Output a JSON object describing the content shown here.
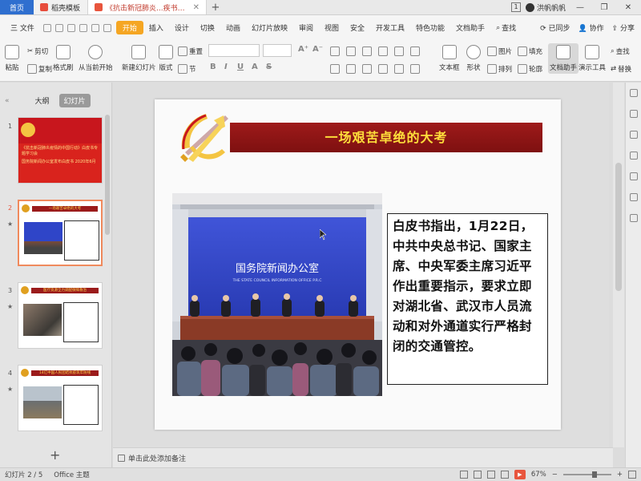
{
  "titlebar": {
    "home_tab": "首页",
    "template_tab": "稻壳模板",
    "doc_tab": "《抗击新冠肺炎...疾书专题学习会",
    "tab_count": "1",
    "user_name": "洪帆帆帆",
    "new_tab": "+"
  },
  "menu": {
    "file": "三 文件",
    "items": [
      "开始",
      "插入",
      "设计",
      "切换",
      "动画",
      "幻灯片放映",
      "审阅",
      "视图",
      "安全",
      "开发工具",
      "特色功能",
      "文档助手"
    ],
    "search": "查找",
    "sync": "已同步",
    "collab": "协作",
    "share": "分享"
  },
  "ribbon": {
    "paste": "粘贴",
    "cut": "剪切",
    "copy": "复制",
    "format_painter": "格式刷",
    "from_current": "从当前开始",
    "new_slide": "新建幻灯片",
    "layout": "版式",
    "section": "节",
    "reset": "重置",
    "textbox": "文本框",
    "shape": "形状",
    "picture": "图片",
    "fill": "填充",
    "arrange": "排列",
    "outline": "轮廓",
    "doc_assistant": "文档助手",
    "present_tools": "演示工具",
    "find": "查找",
    "replace": "替换"
  },
  "left_panel": {
    "outline_tab": "大纲",
    "slides_tab": "幻灯片",
    "thumbs": [
      {
        "num": "1",
        "text": "《抗击新冠肺炎疫情的中国行动》白皮书专题学习会",
        "sub": "国务院新闻办公室发布白皮书 2020年6月"
      },
      {
        "num": "2",
        "title": "一场艰苦卓绝的大考",
        "star": "★"
      },
      {
        "num": "3",
        "title": "医疗资源全力调配保障救治",
        "star": "★"
      },
      {
        "num": "4",
        "title": "14亿中国人民团结抗疫筑牢防线",
        "star": "★"
      }
    ],
    "add": "+"
  },
  "slide": {
    "title": "一场艰苦卓绝的大考",
    "photo_sign_cn": "国务院新闻办公室",
    "photo_sign_en": "THE STATE COUNCIL INFORMATION OFFICE P.R.C",
    "body": "白皮书指出，1月22日，中共中央总书记、国家主席、中央军委主席习近平作出重要指示，要求立即对湖北省、武汉市人员流动和对外通道实行严格封闭的交通管控。"
  },
  "notes": {
    "placeholder": "单击此处添加备注"
  },
  "status": {
    "slide_info": "幻灯片 2 / 5",
    "theme": "Office 主题",
    "zoom": "67%"
  },
  "colors": {
    "accent": "#f5a623",
    "title_bar": "#8e1515",
    "title_text": "#ffdf3b",
    "home_tab": "#2f6fcf"
  }
}
